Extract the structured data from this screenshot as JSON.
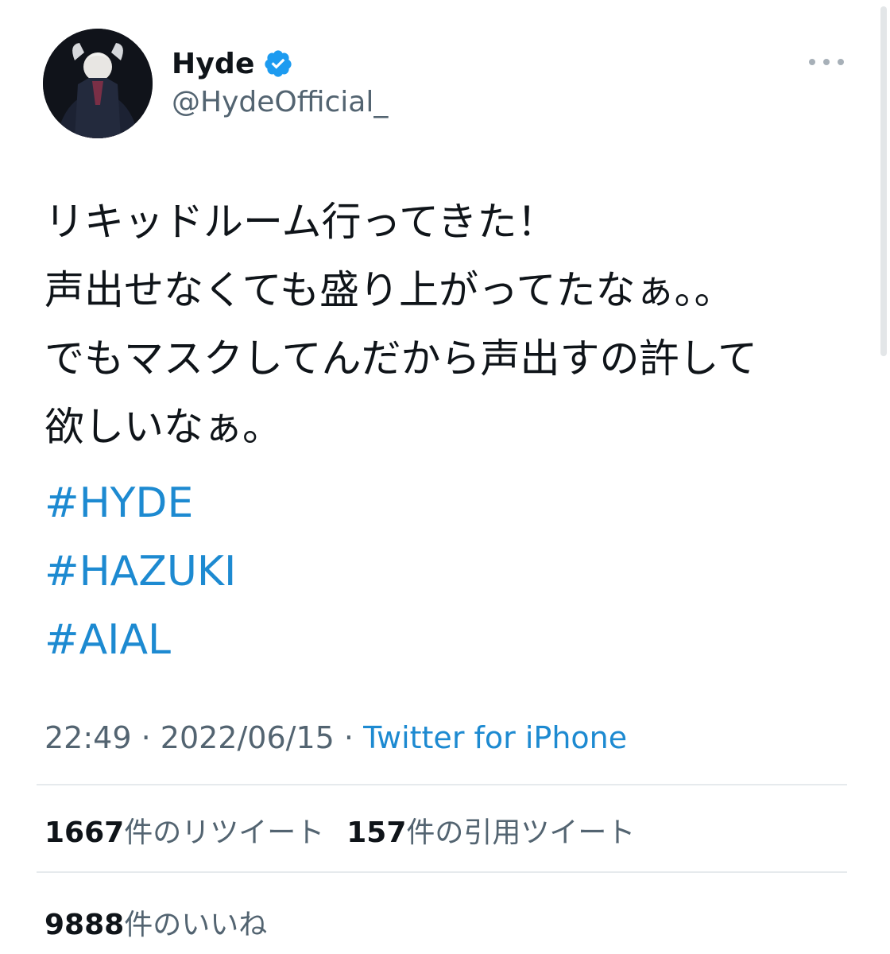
{
  "user": {
    "display_name": "Hyde",
    "handle": "@HydeOfficial_",
    "verified_icon": "verified-badge-icon",
    "avatar": "avatar-photo"
  },
  "tweet": {
    "lines": [
      "リキッドルーム行ってきた！",
      "声出せなくても盛り上がってたなぁ。。",
      "でもマスクしてんだから声出すの許して",
      "欲しいなぁ。"
    ],
    "hashtags": [
      "#HYDE",
      "#HAZUKI",
      "#AIAL"
    ]
  },
  "meta": {
    "time": "22:49",
    "separator": "·",
    "date": "2022/06/15",
    "source": "Twitter for iPhone"
  },
  "stats": {
    "retweets_count": "1667",
    "retweets_label": "件のリツイート",
    "quotes_count": "157",
    "quotes_label": "件の引用ツイート",
    "likes_count": "9888",
    "likes_label": "件のいいね"
  },
  "colors": {
    "link": "#1d8ad1",
    "verified": "#1d9bf0",
    "secondary_text": "#536471",
    "primary_text": "#0f1419"
  }
}
